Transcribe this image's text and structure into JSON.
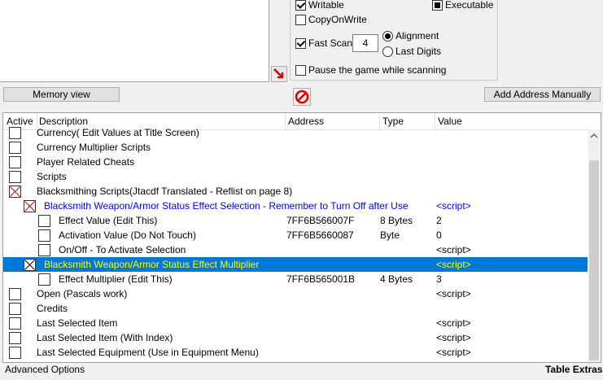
{
  "scan_options": {
    "writable": {
      "label": "Writable",
      "checked": true
    },
    "executable": {
      "label": "Executable",
      "state": "indeterminate"
    },
    "copy_on_write": {
      "label": "CopyOnWrite",
      "checked": false
    },
    "fast_scan": {
      "label": "Fast Scan",
      "checked": true,
      "value": "4"
    },
    "alignment": {
      "label": "Alignment",
      "selected": true
    },
    "last_digits": {
      "label": "Last Digits",
      "selected": false
    },
    "pause_game": {
      "label": "Pause the game while scanning",
      "checked": false
    }
  },
  "buttons": {
    "memory_view": "Memory view",
    "add_address": "Add Address Manually"
  },
  "table": {
    "headers": {
      "active": "Active",
      "description": "Description",
      "address": "Address",
      "type": "Type",
      "value": "Value"
    },
    "rows": [
      {
        "description": "Currency( Edit Values at Title Screen)",
        "address": "",
        "type": "",
        "value": ""
      },
      {
        "description": "Currency Multiplier Scripts",
        "address": "",
        "type": "",
        "value": ""
      },
      {
        "description": "Player Related Cheats",
        "address": "",
        "type": "",
        "value": ""
      },
      {
        "description": "Scripts",
        "address": "",
        "type": "",
        "value": ""
      },
      {
        "description": "Blacksmithing Scripts(Jtacdf Translated - Reflist on page 8)",
        "address": "",
        "type": "",
        "value": ""
      },
      {
        "description": "Blacksmith Weapon/Armor Status Effect Selection - Remember to Turn Off after Use",
        "address": "",
        "type": "",
        "value": "<script>"
      },
      {
        "description": "Effect Value (Edit This)",
        "address": "7FF6B566007F",
        "type": "8 Bytes",
        "value": "2"
      },
      {
        "description": "Activation Value (Do Not Touch)",
        "address": "7FF6B5660087",
        "type": "Byte",
        "value": "0"
      },
      {
        "description": "On/Off - To Activate Selection",
        "address": "",
        "type": "",
        "value": "<script>"
      },
      {
        "description": "Blacksmith Weapon/Armor Status Effect Multiplier",
        "address": "",
        "type": "",
        "value": "<script>"
      },
      {
        "description": "Effect Multiplier (Edit This)",
        "address": "7FF6B565001B",
        "type": "4 Bytes",
        "value": "3"
      },
      {
        "description": "Open (Pascals work)",
        "address": "",
        "type": "",
        "value": "<script>"
      },
      {
        "description": "Credits",
        "address": "",
        "type": "",
        "value": ""
      },
      {
        "description": "Last Selected Item",
        "address": "",
        "type": "",
        "value": "<script>"
      },
      {
        "description": "Last Selected Item (With Index)",
        "address": "",
        "type": "",
        "value": "<script>"
      },
      {
        "description": "Last Selected Equipment (Use in Equipment Menu)",
        "address": "",
        "type": "",
        "value": "<script>"
      }
    ]
  },
  "footer": {
    "left": "Advanced Options",
    "right": "Table Extras"
  },
  "colors": {
    "selection": "#0078d7",
    "selection_text": "#ffff00",
    "script_text": "#0000ff",
    "active_x": "#cc0000"
  }
}
